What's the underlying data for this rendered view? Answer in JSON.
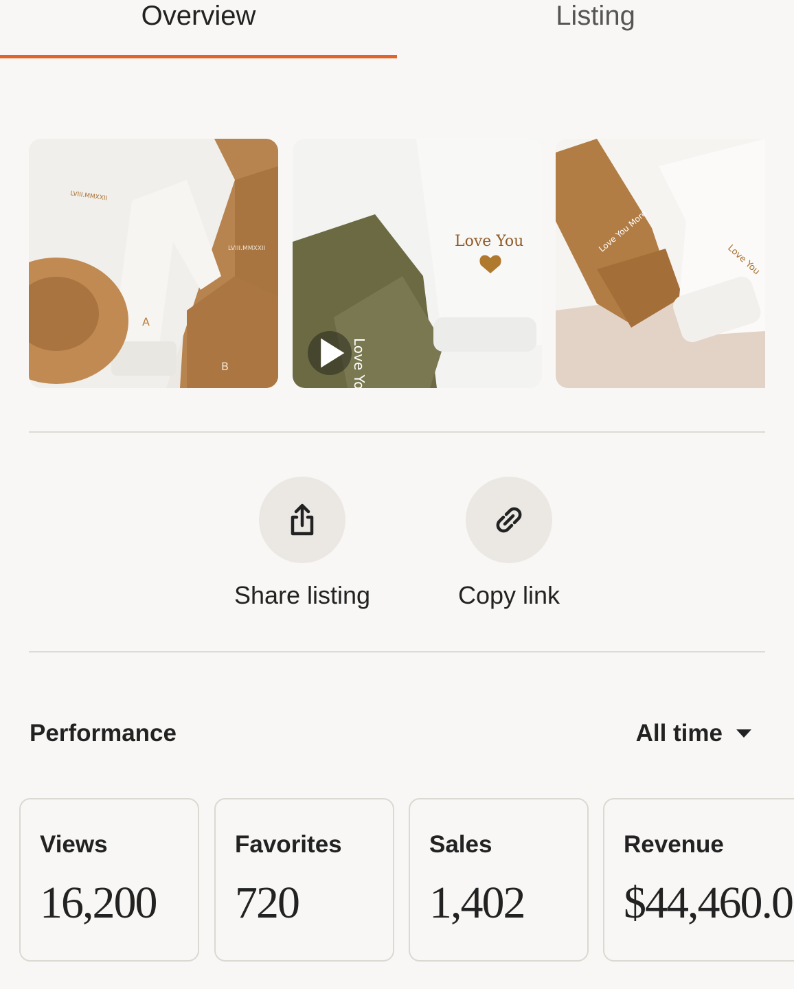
{
  "tabs": [
    {
      "label": "Overview",
      "active": true
    },
    {
      "label": "Listing",
      "active": false
    }
  ],
  "accent_color": "#e0652b",
  "media": [
    {
      "type": "image",
      "embroidery": [
        "LVIII.MMXXII",
        "LVIII.MMXXII",
        "A",
        "B"
      ]
    },
    {
      "type": "video",
      "icon": "play-icon",
      "embroidery": [
        "Love You",
        "Love You More"
      ]
    },
    {
      "type": "image",
      "embroidery": [
        "Love You More",
        "Love You"
      ]
    }
  ],
  "actions": {
    "share": {
      "label": "Share listing",
      "icon": "share-icon"
    },
    "copy": {
      "label": "Copy link",
      "icon": "link-icon"
    }
  },
  "performance": {
    "title": "Performance",
    "range": "All time",
    "stats": [
      {
        "label": "Views",
        "value": "16,200"
      },
      {
        "label": "Favorites",
        "value": "720"
      },
      {
        "label": "Sales",
        "value": "1,402"
      },
      {
        "label": "Revenue",
        "value": "$44,460.0"
      }
    ]
  }
}
